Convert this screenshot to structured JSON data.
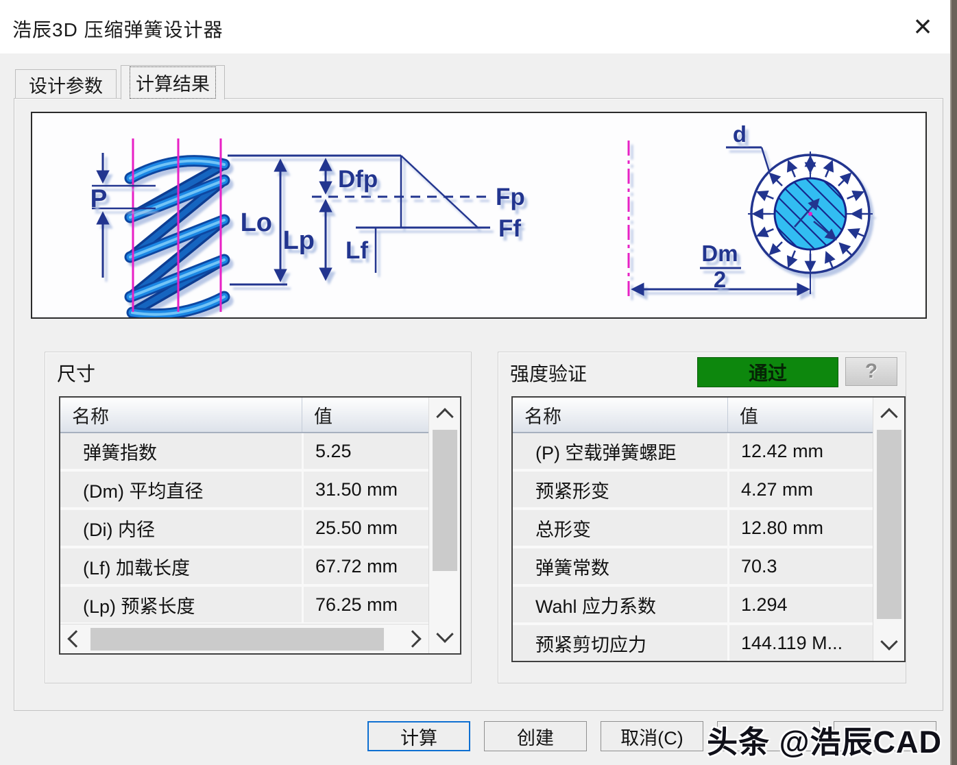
{
  "window": {
    "title": "浩辰3D 压缩弹簧设计器",
    "close_icon": "×"
  },
  "tabs": [
    {
      "label": "设计参数",
      "active": false
    },
    {
      "label": "计算结果",
      "active": true
    }
  ],
  "diagram": {
    "labels": {
      "pitch": "P",
      "free_length": "Lo",
      "preload_length": "Lp",
      "load_length": "Lf",
      "preload_deflection": "Dfp",
      "preload_force": "Fp",
      "load_force": "Ff",
      "wire_diameter": "d",
      "mean_diameter_numerator": "Dm",
      "mean_diameter_denominator": "2"
    }
  },
  "dimensions_group": {
    "title": "尺寸",
    "columns": {
      "name": "名称",
      "value": "值"
    },
    "rows": [
      {
        "name": "弹簧指数",
        "value": "5.25"
      },
      {
        "name": "(Dm) 平均直径",
        "value": "31.50 mm"
      },
      {
        "name": "(Di) 内径",
        "value": "25.50 mm"
      },
      {
        "name": "(Lf) 加载长度",
        "value": "67.72 mm"
      },
      {
        "name": "(Lp) 预紧长度",
        "value": "76.25 mm"
      }
    ]
  },
  "strength_group": {
    "title": "强度验证",
    "status_badge": "通过",
    "help_label": "?",
    "columns": {
      "name": "名称",
      "value": "值"
    },
    "rows": [
      {
        "name": "(P) 空载弹簧螺距",
        "value": "12.42 mm"
      },
      {
        "name": "预紧形变",
        "value": "4.27 mm"
      },
      {
        "name": "总形变",
        "value": "12.80 mm"
      },
      {
        "name": "弹簧常数",
        "value": "70.3"
      },
      {
        "name": "Wahl 应力系数",
        "value": "1.294"
      },
      {
        "name": "预紧剪切应力",
        "value": "144.119 M..."
      }
    ]
  },
  "footer": {
    "buttons": [
      {
        "label": "计算"
      },
      {
        "label": "创建"
      },
      {
        "label": "取消(C)"
      },
      {
        "label": ""
      },
      {
        "label": ""
      }
    ]
  },
  "watermark": "头条 @浩辰CAD",
  "colors": {
    "dialog_bg": "#f0f0f0",
    "titlebar_bg": "#ffffff",
    "pass_green": "#0d870d",
    "default_button_border": "#0d6fd1",
    "diagram_navy": "#24348f",
    "diagram_magenta": "#e820c5",
    "spring_blue": "#1e88e5",
    "section_cyan": "#33bdf2"
  }
}
